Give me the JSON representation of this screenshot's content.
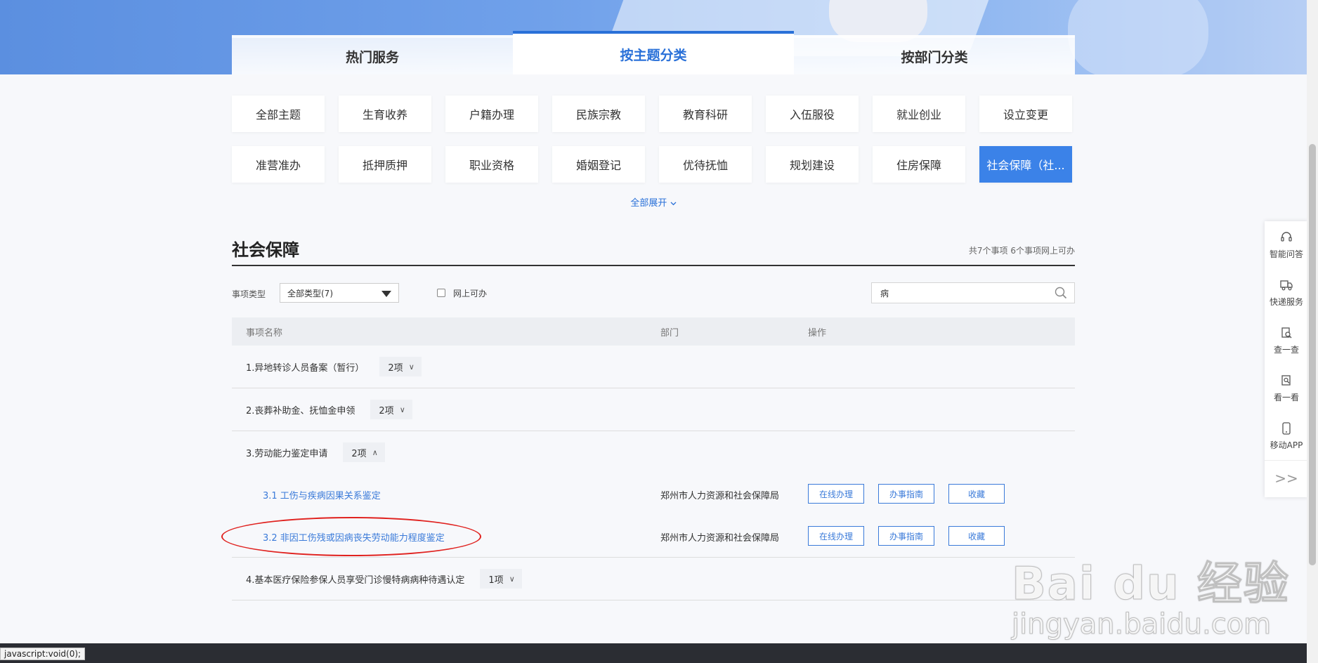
{
  "tabs": [
    {
      "label": "热门服务"
    },
    {
      "label": "按主题分类"
    },
    {
      "label": "按部门分类"
    }
  ],
  "themes": [
    "全部主题",
    "生育收养",
    "户籍办理",
    "民族宗教",
    "教育科研",
    "入伍服役",
    "就业创业",
    "设立变更",
    "准营准办",
    "抵押质押",
    "职业资格",
    "婚姻登记",
    "优待抚恤",
    "规划建设",
    "住房保障",
    "社会保障（社..."
  ],
  "expand_label": "全部展开",
  "section": {
    "title": "社会保障",
    "summary": "共7个事项 6个事项网上可办"
  },
  "filters": {
    "type_label": "事项类型",
    "type_value": "全部类型(7)",
    "online_label": "网上可办",
    "search_value": "病"
  },
  "table": {
    "headers": {
      "name": "事项名称",
      "dept": "部门",
      "ops": "操作"
    },
    "items": [
      {
        "title": "1.异地转诊人员备案（暂行）",
        "count": "2项",
        "chevron": "∨"
      },
      {
        "title": "2.丧葬补助金、抚恤金申领",
        "count": "2项",
        "chevron": "∨"
      },
      {
        "title": "3.劳动能力鉴定申请",
        "count": "2项",
        "chevron": "∧"
      },
      {
        "title": "4.基本医疗保险参保人员享受门诊慢特病病种待遇认定",
        "count": "1项",
        "chevron": "∨"
      }
    ],
    "subitems": [
      {
        "title": "3.1 工伤与疾病因果关系鉴定",
        "dept": "郑州市人力资源和社会保障局",
        "btn1": "在线办理",
        "btn2": "办事指南",
        "btn3": "收藏"
      },
      {
        "title": "3.2 非因工伤残或因病丧失劳动能力程度鉴定",
        "dept": "郑州市人力资源和社会保障局",
        "btn1": "在线办理",
        "btn2": "办事指南",
        "btn3": "收藏"
      }
    ]
  },
  "float_bar": {
    "items": [
      {
        "label": "智能问答",
        "icon": "headset-icon"
      },
      {
        "label": "快递服务",
        "icon": "truck-icon"
      },
      {
        "label": "查一查",
        "icon": "search-doc-icon"
      },
      {
        "label": "看一看",
        "icon": "view-doc-icon"
      },
      {
        "label": "移动APP",
        "icon": "phone-icon"
      }
    ],
    "more": ">>"
  },
  "status_bar": "javascript:void(0);",
  "watermark": {
    "line1": "Bai du 经验",
    "line2": "jingyan.baidu.com"
  },
  "colors": {
    "accent": "#2970d8",
    "active_chip": "#3b82e8",
    "highlight": "#e0221f"
  }
}
